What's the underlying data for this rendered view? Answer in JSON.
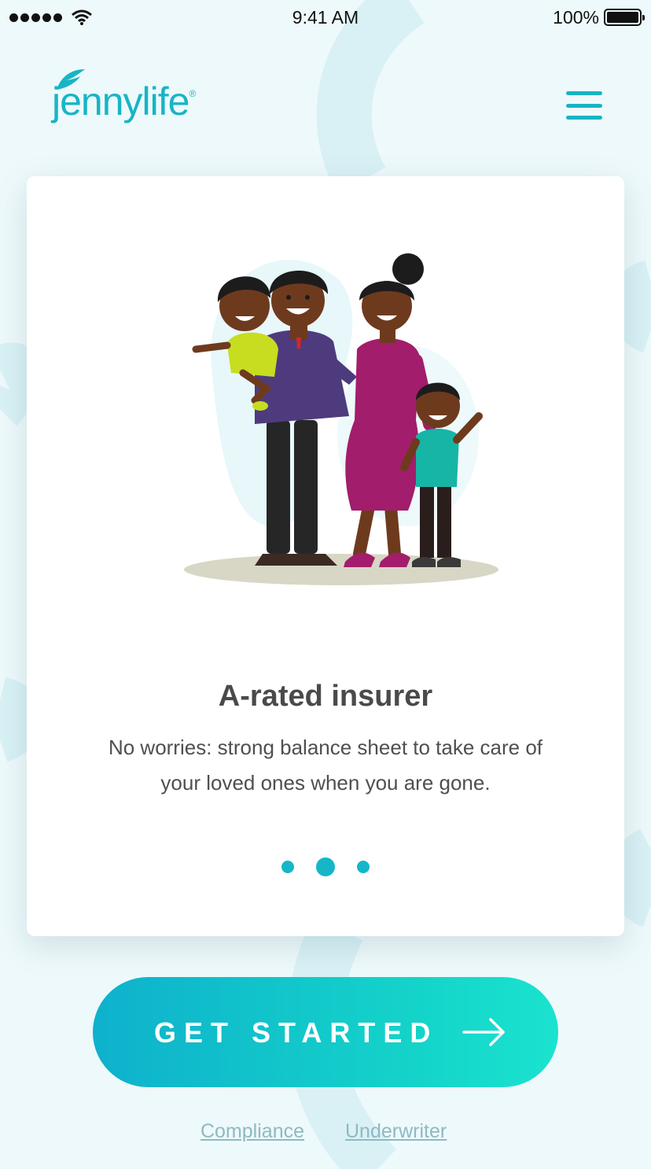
{
  "status_bar": {
    "time": "9:41 AM",
    "battery": "100%",
    "battery_level": 1.0
  },
  "header": {
    "logo_text": "jennylife",
    "logo_mark": "®",
    "menu_icon": "hamburger-menu-icon"
  },
  "card": {
    "illustration": "family-illustration",
    "title": "A-rated insurer",
    "body": "No worries: strong balance sheet to take care of your loved ones when you are gone.",
    "pagination": {
      "total": 3,
      "active_index": 1
    }
  },
  "cta": {
    "label": "GET STARTED",
    "icon": "arrow-right-icon"
  },
  "footer": {
    "links": [
      "Compliance",
      "Underwriter"
    ]
  },
  "colors": {
    "brand": "#17b5c5",
    "background": "#eef9fb",
    "cta_start": "#0eb1cc",
    "cta_end": "#1ae3cf",
    "title_text": "#4a4a4a",
    "link": "#8fb9c3"
  }
}
